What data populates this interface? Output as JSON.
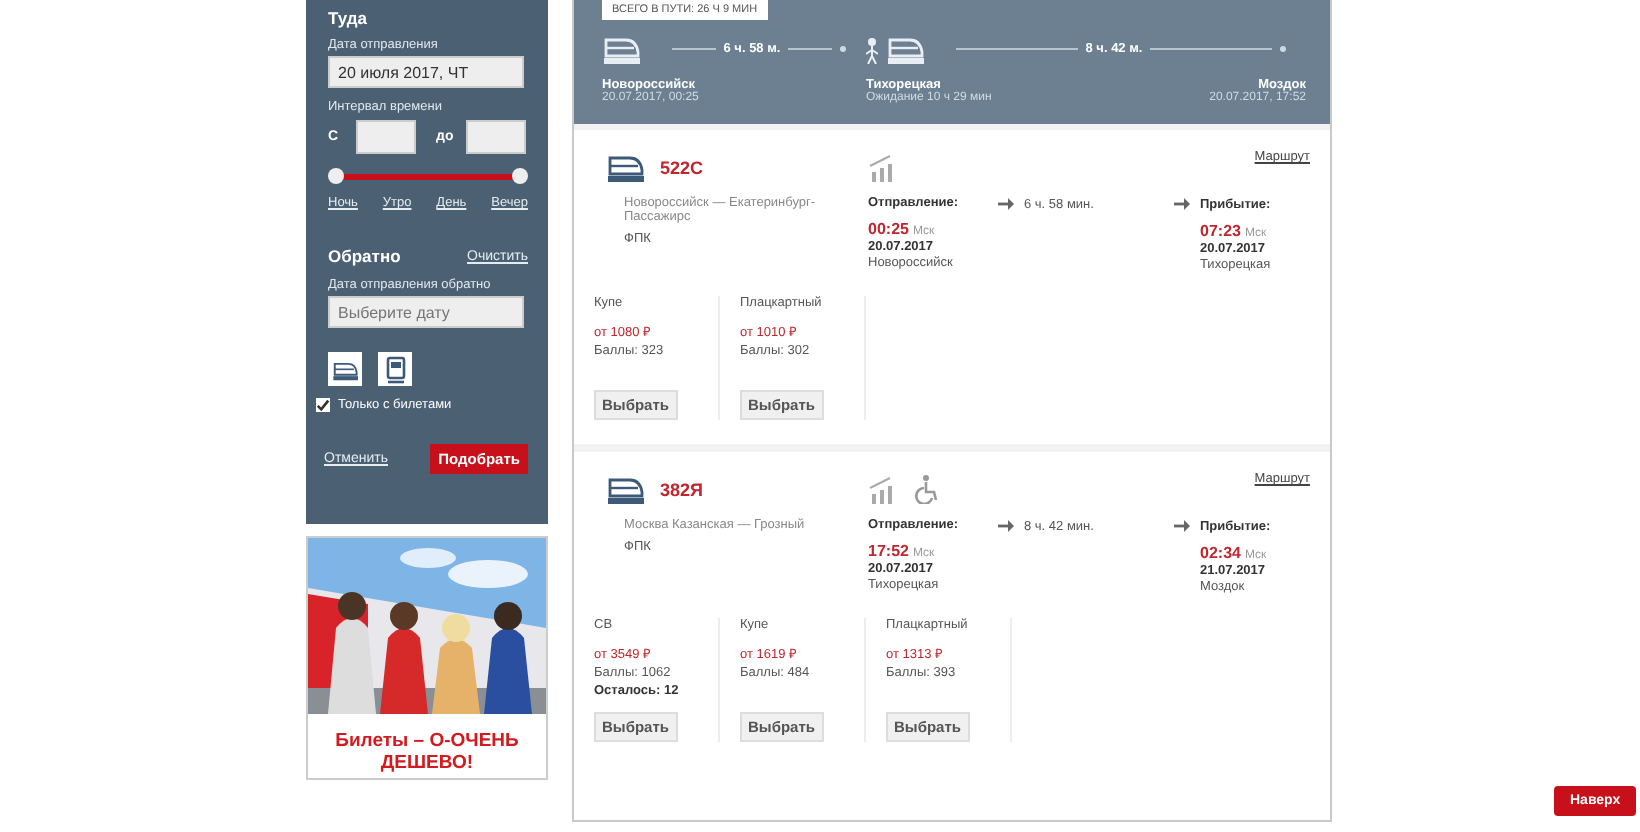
{
  "search": {
    "title": "Туда",
    "date_label": "Дата отправления",
    "date_value": "20 июля 2017, ЧТ",
    "interval_label": "Интервал времени",
    "from_label": "С",
    "to_label": "до",
    "slider_thumbs": [
      {
        "level": 0
      },
      {
        "level": 1
      }
    ],
    "periods": [
      "Ночь",
      "Утро",
      "День",
      "Вечер"
    ],
    "return_title": "Обратно",
    "clear_link": "Очистить",
    "return_date_label": "Дата отправления обратно",
    "return_date_placeholder": "Выберите дату",
    "only_with_tickets": {
      "label": "Только с билетами",
      "checked": true
    },
    "cancel_link": "Отменить",
    "submit_button": "Подобрать"
  },
  "ad": {
    "kind": "picture",
    "caption": "Билеты – О-ОЧЕНЬ ДЕШЕВО!"
  },
  "route": {
    "total": "ВСЕГО В ПУТИ: 26 Ч 9 МИН",
    "legs": [
      {
        "duration": "6 ч. 58 м."
      },
      {
        "duration": "8 ч. 42 м."
      }
    ],
    "stops": [
      {
        "name": "Новороссийск",
        "note": "20.07.2017, 00:25"
      },
      {
        "name": "Тихорецкая",
        "note": "Ожидание 10 ч 29 мин"
      },
      {
        "name": "Моздок",
        "note": "20.07.2017, 17:52"
      }
    ]
  },
  "trains": [
    {
      "number": "522С",
      "route": "Новороссийск — Екатеринбург-Пассажирс",
      "carrier": "ФПК",
      "accessible": false,
      "route_link": "Маршрут",
      "departure": {
        "label": "Отправление:",
        "time": "00:25",
        "tz": "Мск",
        "date": "20.07.2017",
        "station": "Новороссийск"
      },
      "duration": "6 ч. 58 мин.",
      "arrival": {
        "label": "Прибытие:",
        "time": "07:23",
        "tz": "Мск",
        "date": "20.07.2017",
        "station": "Тихорецкая"
      },
      "classes": [
        {
          "name": "Купе",
          "price": "от 1080 ₽",
          "points": "Баллы: 323",
          "button": "Выбрать"
        },
        {
          "name": "Плацкартный",
          "price": "от 1010 ₽",
          "points": "Баллы: 302",
          "button": "Выбрать"
        }
      ]
    },
    {
      "number": "382Я",
      "route": "Москва Казанская — Грозный",
      "carrier": "ФПК",
      "accessible": true,
      "route_link": "Маршрут",
      "departure": {
        "label": "Отправление:",
        "time": "17:52",
        "tz": "Мск",
        "date": "20.07.2017",
        "station": "Тихорецкая"
      },
      "duration": "8 ч. 42 мин.",
      "arrival": {
        "label": "Прибытие:",
        "time": "02:34",
        "tz": "Мск",
        "date": "21.07.2017",
        "station": "Моздок"
      },
      "classes": [
        {
          "name": "СВ",
          "price": "от 3549 ₽",
          "points": "Баллы: 1062",
          "remaining": "Осталось: 12",
          "button": "Выбрать"
        },
        {
          "name": "Купе",
          "price": "от 1619 ₽",
          "points": "Баллы: 484",
          "button": "Выбрать"
        },
        {
          "name": "Плацкартный",
          "price": "от 1313 ₽",
          "points": "Баллы: 393",
          "button": "Выбрать"
        }
      ]
    }
  ],
  "scroll_top_button": "Наверх"
}
